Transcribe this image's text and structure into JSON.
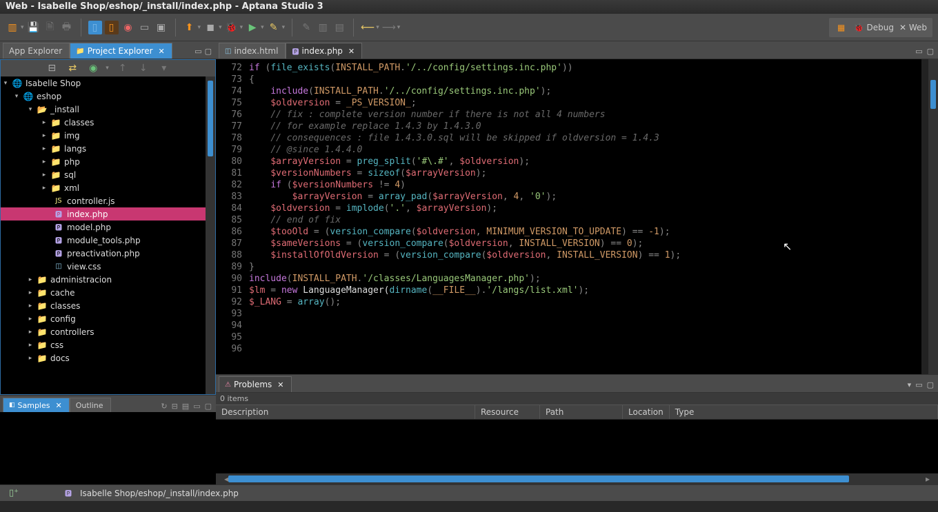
{
  "window": {
    "title": "Web - Isabelle Shop/eshop/_install/index.php - Aptana Studio 3"
  },
  "perspective": {
    "debug": "Debug",
    "web": "Web"
  },
  "leftTabs": {
    "appExplorer": "App Explorer",
    "projectExplorer": "Project Explorer"
  },
  "tree": {
    "root": "Isabelle Shop",
    "eshop": "eshop",
    "install": "_install",
    "classes": "classes",
    "img": "img",
    "langs": "langs",
    "php": "php",
    "sql": "sql",
    "xml": "xml",
    "controller": "controller.js",
    "index": "index.php",
    "model": "model.php",
    "module_tools": "module_tools.php",
    "preactivation": "preactivation.php",
    "viewcss": "view.css",
    "administracion": "administracion",
    "cache": "cache",
    "classes2": "classes",
    "config": "config",
    "controllers": "controllers",
    "css": "css",
    "docs": "docs"
  },
  "samples": {
    "samples": "Samples",
    "outline": "Outline"
  },
  "editorTabs": {
    "html": "index.html",
    "php": "index.php"
  },
  "gutter": [
    "72",
    "73",
    "74",
    "75",
    "76",
    "77",
    "78",
    "79",
    "80",
    "81",
    "82",
    "83",
    "84",
    "85",
    "86",
    "87",
    "88",
    "89",
    "90",
    "91",
    "92",
    "93",
    "94",
    "95",
    "96",
    ""
  ],
  "code": [
    [
      [
        "k-purple",
        "if"
      ],
      [
        "k-grey",
        " ("
      ],
      [
        "k-cyan",
        "file_exists"
      ],
      [
        "k-grey",
        "("
      ],
      [
        "k-orange",
        "INSTALL_PATH"
      ],
      [
        "k-grey",
        "."
      ],
      [
        "k-green",
        "'/../config/settings.inc.php'"
      ],
      [
        "k-grey",
        "))"
      ]
    ],
    [
      [
        "k-grey",
        "{"
      ]
    ],
    [
      [
        "k-white",
        "    "
      ],
      [
        "k-purple",
        "include"
      ],
      [
        "k-grey",
        "("
      ],
      [
        "k-orange",
        "INSTALL_PATH"
      ],
      [
        "k-grey",
        "."
      ],
      [
        "k-green",
        "'/../config/settings.inc.php'"
      ],
      [
        "k-grey",
        ");"
      ]
    ],
    [
      [
        "k-white",
        "    "
      ],
      [
        "k-red",
        "$oldversion"
      ],
      [
        "k-grey",
        " = "
      ],
      [
        "k-orange",
        "_PS_VERSION_"
      ],
      [
        "k-grey",
        ";"
      ]
    ],
    [
      [
        "k-white",
        ""
      ]
    ],
    [
      [
        "k-white",
        "    "
      ],
      [
        "k-comment",
        "// fix : complete version number if there is not all 4 numbers"
      ]
    ],
    [
      [
        "k-white",
        "    "
      ],
      [
        "k-comment",
        "// for example replace 1.4.3 by 1.4.3.0"
      ]
    ],
    [
      [
        "k-white",
        "    "
      ],
      [
        "k-comment",
        "// consequences : file 1.4.3.0.sql will be skipped if oldversion = 1.4.3"
      ]
    ],
    [
      [
        "k-white",
        "    "
      ],
      [
        "k-comment",
        "// @since 1.4.4.0"
      ]
    ],
    [
      [
        "k-white",
        "    "
      ],
      [
        "k-red",
        "$arrayVersion"
      ],
      [
        "k-grey",
        " = "
      ],
      [
        "k-cyan",
        "preg_split"
      ],
      [
        "k-grey",
        "("
      ],
      [
        "k-green",
        "'#\\.#'"
      ],
      [
        "k-grey",
        ", "
      ],
      [
        "k-red",
        "$oldversion"
      ],
      [
        "k-grey",
        ");"
      ]
    ],
    [
      [
        "k-white",
        "    "
      ],
      [
        "k-red",
        "$versionNumbers"
      ],
      [
        "k-grey",
        " = "
      ],
      [
        "k-cyan",
        "sizeof"
      ],
      [
        "k-grey",
        "("
      ],
      [
        "k-red",
        "$arrayVersion"
      ],
      [
        "k-grey",
        ");"
      ]
    ],
    [
      [
        "k-white",
        ""
      ]
    ],
    [
      [
        "k-white",
        "    "
      ],
      [
        "k-purple",
        "if"
      ],
      [
        "k-grey",
        " ("
      ],
      [
        "k-red",
        "$versionNumbers"
      ],
      [
        "k-grey",
        " != "
      ],
      [
        "k-orange",
        "4"
      ],
      [
        "k-grey",
        ")"
      ]
    ],
    [
      [
        "k-white",
        "        "
      ],
      [
        "k-red",
        "$arrayVersion"
      ],
      [
        "k-grey",
        " = "
      ],
      [
        "k-cyan",
        "array_pad"
      ],
      [
        "k-grey",
        "("
      ],
      [
        "k-red",
        "$arrayVersion"
      ],
      [
        "k-grey",
        ", "
      ],
      [
        "k-orange",
        "4"
      ],
      [
        "k-grey",
        ", "
      ],
      [
        "k-green",
        "'0'"
      ],
      [
        "k-grey",
        ");"
      ]
    ],
    [
      [
        "k-white",
        ""
      ]
    ],
    [
      [
        "k-white",
        "    "
      ],
      [
        "k-red",
        "$oldversion"
      ],
      [
        "k-grey",
        " = "
      ],
      [
        "k-cyan",
        "implode"
      ],
      [
        "k-grey",
        "("
      ],
      [
        "k-green",
        "'.'"
      ],
      [
        "k-grey",
        ", "
      ],
      [
        "k-red",
        "$arrayVersion"
      ],
      [
        "k-grey",
        ");"
      ]
    ],
    [
      [
        "k-white",
        "    "
      ],
      [
        "k-comment",
        "// end of fix"
      ]
    ],
    [
      [
        "k-white",
        ""
      ]
    ],
    [
      [
        "k-white",
        "    "
      ],
      [
        "k-red",
        "$tooOld"
      ],
      [
        "k-grey",
        " = ("
      ],
      [
        "k-cyan",
        "version_compare"
      ],
      [
        "k-grey",
        "("
      ],
      [
        "k-red",
        "$oldversion"
      ],
      [
        "k-grey",
        ", "
      ],
      [
        "k-orange",
        "MINIMUM_VERSION_TO_UPDATE"
      ],
      [
        "k-grey",
        ") == "
      ],
      [
        "k-orange",
        "-1"
      ],
      [
        "k-grey",
        ");"
      ]
    ],
    [
      [
        "k-white",
        "    "
      ],
      [
        "k-red",
        "$sameVersions"
      ],
      [
        "k-grey",
        " = ("
      ],
      [
        "k-cyan",
        "version_compare"
      ],
      [
        "k-grey",
        "("
      ],
      [
        "k-red",
        "$oldversion"
      ],
      [
        "k-grey",
        ", "
      ],
      [
        "k-orange",
        "INSTALL_VERSION"
      ],
      [
        "k-grey",
        ") == "
      ],
      [
        "k-orange",
        "0"
      ],
      [
        "k-grey",
        ");"
      ]
    ],
    [
      [
        "k-white",
        "    "
      ],
      [
        "k-red",
        "$installOfOldVersion"
      ],
      [
        "k-grey",
        " = ("
      ],
      [
        "k-cyan",
        "version_compare"
      ],
      [
        "k-grey",
        "("
      ],
      [
        "k-red",
        "$oldversion"
      ],
      [
        "k-grey",
        ", "
      ],
      [
        "k-orange",
        "INSTALL_VERSION"
      ],
      [
        "k-grey",
        ") == "
      ],
      [
        "k-orange",
        "1"
      ],
      [
        "k-grey",
        ");"
      ]
    ],
    [
      [
        "k-grey",
        "}"
      ]
    ],
    [
      [
        "k-white",
        ""
      ]
    ],
    [
      [
        "k-purple",
        "include"
      ],
      [
        "k-grey",
        "("
      ],
      [
        "k-orange",
        "INSTALL_PATH"
      ],
      [
        "k-grey",
        "."
      ],
      [
        "k-green",
        "'/classes/LanguagesManager.php'"
      ],
      [
        "k-grey",
        ");"
      ]
    ],
    [
      [
        "k-red",
        "$lm"
      ],
      [
        "k-grey",
        " = "
      ],
      [
        "k-purple",
        "new"
      ],
      [
        "k-white",
        " LanguageManager("
      ],
      [
        "k-cyan",
        "dirname"
      ],
      [
        "k-grey",
        "("
      ],
      [
        "k-orange",
        "__FILE__"
      ],
      [
        "k-grey",
        ")."
      ],
      [
        "k-green",
        "'/langs/list.xml'"
      ],
      [
        "k-grey",
        ");"
      ]
    ],
    [
      [
        "k-red",
        "$_LANG"
      ],
      [
        "k-grey",
        " = "
      ],
      [
        "k-cyan",
        "array"
      ],
      [
        "k-grey",
        "();"
      ]
    ]
  ],
  "problems": {
    "tab": "Problems",
    "count": "0 items",
    "cols": {
      "desc": "Description",
      "res": "Resource",
      "path": "Path",
      "loc": "Location",
      "type": "Type"
    }
  },
  "status": {
    "path": "Isabelle Shop/eshop/_install/index.php"
  }
}
